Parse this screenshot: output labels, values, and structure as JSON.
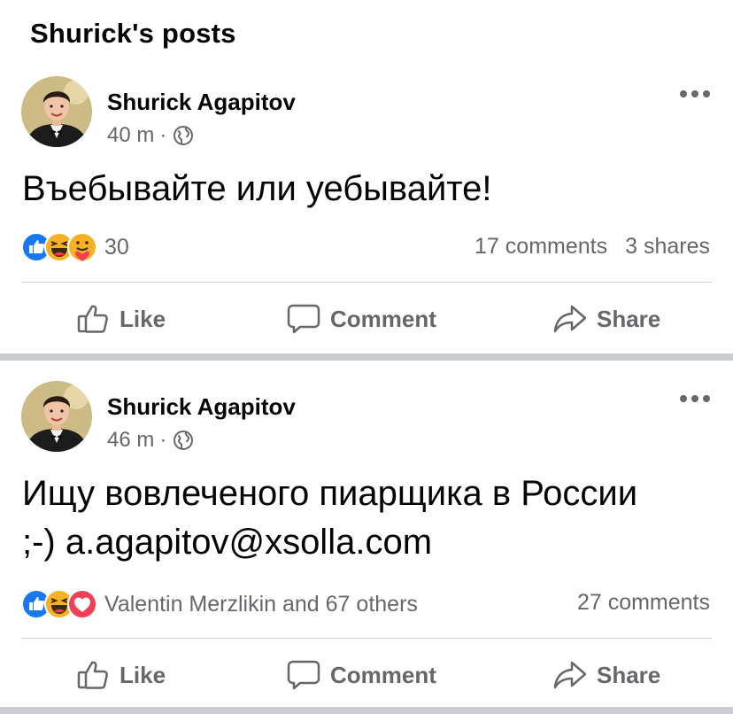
{
  "page": {
    "section_title": "Shurick's posts"
  },
  "posts": [
    {
      "author": "Shurick Agapitov",
      "time": "40 m",
      "dot": "·",
      "text": "Въебывайте или уебывайте!",
      "reactions": [
        "like",
        "haha",
        "care"
      ],
      "reaction_count": "30",
      "comments": "17 comments",
      "shares": "3 shares"
    },
    {
      "author": "Shurick Agapitov",
      "time": "46 m",
      "dot": "·",
      "text": "Ищу вовлеченого пиарщика в России ;-) a.agapitov@xsolla.com",
      "reactions": [
        "like",
        "haha",
        "love"
      ],
      "reaction_count": "Valentin Merzlikin and 67 others",
      "comments": "27 comments"
    }
  ],
  "actions": {
    "like": "Like",
    "comment": "Comment",
    "share": "Share"
  },
  "icons": {
    "audience": "globe-icon",
    "more": "more-dots-icon",
    "like": "thumbs-up-icon",
    "comment": "speech-bubble-icon",
    "share": "share-arrow-icon"
  },
  "colors": {
    "like_blue": "#1877f2",
    "haha_yellow": "#f7b125",
    "love_red": "#f33e58",
    "secondary_text": "#65676b",
    "separator": "#c9ccd1"
  }
}
